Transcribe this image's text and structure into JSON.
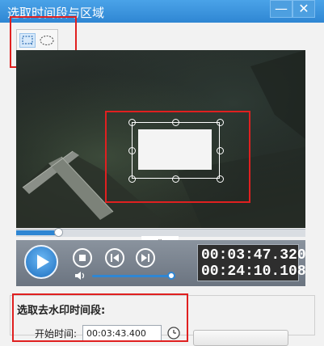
{
  "window": {
    "title": "选取时间段与区域",
    "minimize_glyph": "—",
    "close_glyph": "✕"
  },
  "toolbar": {
    "tools": [
      {
        "name": "rect-select-icon",
        "selected": true
      },
      {
        "name": "ellipse-select-icon",
        "selected": false
      }
    ]
  },
  "player": {
    "progress_fraction": 0.145,
    "volume_fraction": 0.96,
    "current_time": "00:03:47.320",
    "total_time": "00:24:10.108",
    "collapse_glyph": "⌄"
  },
  "watermark_section": {
    "title": "选取去水印时间段:",
    "start_label": "开始时间:",
    "start_value": "00:03:43.400"
  },
  "colors": {
    "title_bar": "#2f86d3",
    "accent": "#2f86d3",
    "highlight": "#e02020",
    "control_panel": "#7a838e"
  }
}
